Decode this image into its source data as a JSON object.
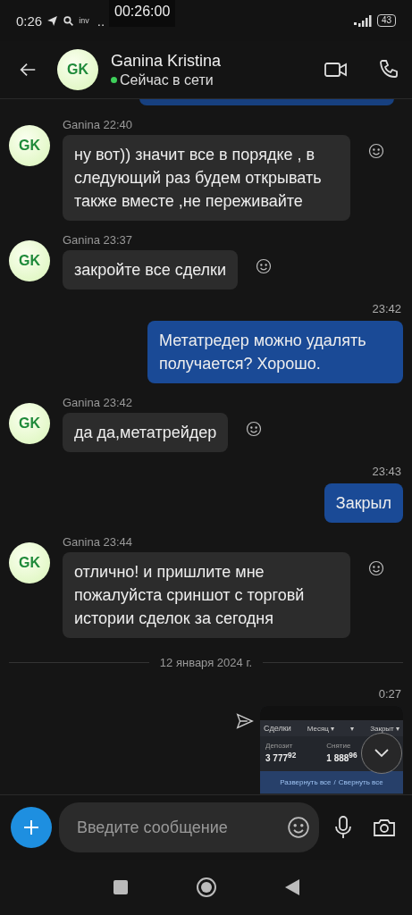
{
  "status_bar": {
    "time": "0:26",
    "app_text": "inv",
    "dots": "..",
    "recording_timer": "00:26:00",
    "battery": "43"
  },
  "header": {
    "initials": "GK",
    "name": "Ganina Kristina",
    "status": "Сейчас в сети",
    "online": true
  },
  "messages": [
    {
      "kind": "incoming",
      "initials": "GK",
      "sender": "Ganina",
      "time": "22:40",
      "text": "ну вот)) значит все в порядке , в следующий раз будем открывать также вместе ,не переживайте"
    },
    {
      "kind": "incoming",
      "initials": "GK",
      "sender": "Ganina",
      "time": "23:37",
      "text": "закройте все сделки"
    },
    {
      "kind": "outgoing",
      "time": "23:42",
      "text": "Метатредер можно удалять получается? Хорошо."
    },
    {
      "kind": "incoming",
      "initials": "GK",
      "sender": "Ganina",
      "time": "23:42",
      "text": "да да,метатрейдер"
    },
    {
      "kind": "outgoing",
      "time": "23:43",
      "text": "Закрыл"
    },
    {
      "kind": "incoming",
      "initials": "GK",
      "sender": "Ganina",
      "time": "23:44",
      "text": "отлично! и пришлите мне пожалуйста сриншот с торговй истории сделок за сегодня"
    },
    {
      "kind": "date",
      "text": "12 января 2024 г."
    },
    {
      "kind": "image",
      "time": "0:27",
      "screenshot": {
        "title": "Сделки",
        "filter_1": "Месяц ▾",
        "filter_2": "▾",
        "filter_3": "Закрыт ▾",
        "deposit_label": "Депозит",
        "deposit_value": "3 777",
        "deposit_cents": "92",
        "withdraw_label": "Снятие",
        "withdraw_value": "1 888",
        "withdraw_cents": "96",
        "expand_all": "Развернуть все",
        "separator": "/",
        "collapse_all": "Свернуть все"
      }
    }
  ],
  "composer": {
    "placeholder": "Введите сообщение"
  }
}
